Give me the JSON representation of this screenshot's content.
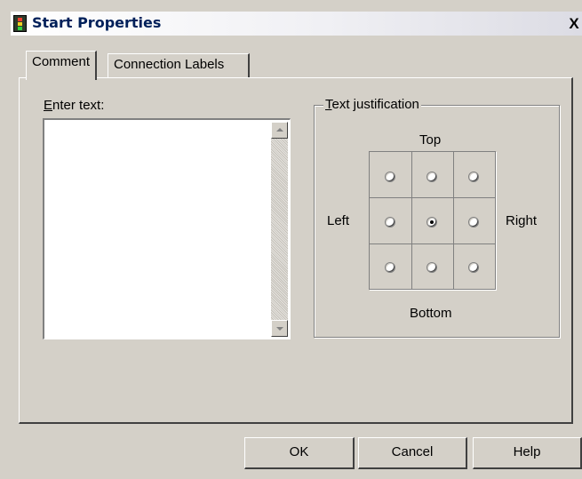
{
  "window": {
    "title": "Start Properties",
    "close_symbol": "X"
  },
  "tabs": [
    {
      "label": "Comment",
      "active": true
    },
    {
      "label": "Connection Labels",
      "active": false
    }
  ],
  "comment": {
    "enter_text_accel": "E",
    "enter_text_rest": "nter text:",
    "text_value": ""
  },
  "justification": {
    "group_accel": "T",
    "group_rest": "ext justification",
    "top": "Top",
    "bottom": "Bottom",
    "left": "Left",
    "right": "Right",
    "selected": "middle-center"
  },
  "buttons": {
    "ok": "OK",
    "cancel": "Cancel",
    "help": "Help"
  },
  "colors": {
    "dialog_bg": "#d4d0c8",
    "title_text": "#00205a"
  }
}
